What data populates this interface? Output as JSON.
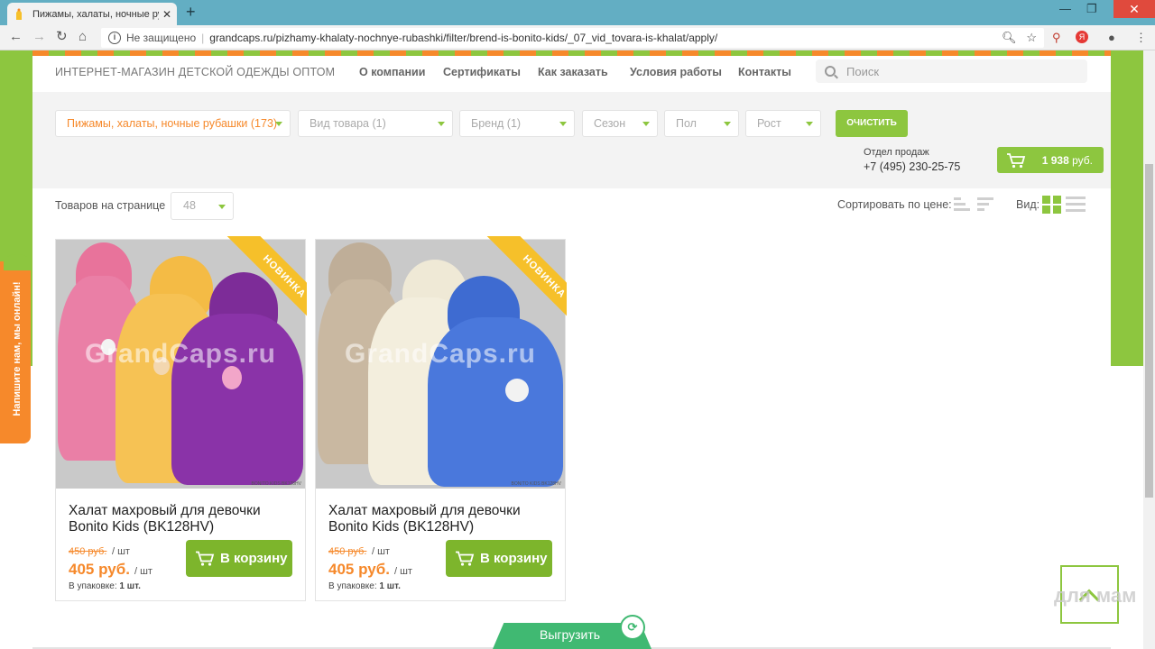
{
  "browser": {
    "tab_title": "Пижамы, халаты, ночные рубаш",
    "tab_close": "✕",
    "new_tab": "+",
    "security_label": "Не защищено",
    "separator": "|",
    "url": "grandcaps.ru/pizhamy-khalaty-nochnye-rubashki/filter/brend-is-bonito-kids/_07_vid_tovara-is-khalat/apply/",
    "window_controls": [
      "—",
      "❐",
      "✕"
    ]
  },
  "header": {
    "brand": "ИНТЕРНЕТ-МАГАЗИН ДЕТСКОЙ ОДЕЖДЫ ОПТОМ",
    "nav": [
      "О компании",
      "Сертификаты",
      "Как заказать",
      "Условия работы",
      "Контакты"
    ],
    "search_placeholder": "Поиск"
  },
  "filters": {
    "category": "Пижамы, халаты, ночные рубашки (173)",
    "product_type": "Вид товара (1)",
    "brand": "Бренд (1)",
    "season": "Сезон",
    "gender": "Пол",
    "height": "Рост",
    "clear_label": "ОЧИСТИТЬ"
  },
  "sales": {
    "label": "Отдел продаж",
    "phone": "+7 (495) 230-25-75"
  },
  "cart": {
    "total": "1 938",
    "currency": "руб."
  },
  "toolbar": {
    "per_page_label": "Товаров на странице",
    "per_page_value": "48",
    "sort_label": "Сортировать по цене:",
    "view_label": "Вид:"
  },
  "products": [
    {
      "badge": "НОВИНКА",
      "watermark": "GrandCaps.ru",
      "img_caption": "BONITO KIDS BK128HV",
      "name": "Халат махровый для девочки Bonito Kids (BK128HV)",
      "old_price": "450 руб.",
      "price": "405 руб.",
      "unit": "/ шт",
      "pack_label": "В упаковке:",
      "pack_value": "1 шт.",
      "buy_label": "В корзину"
    },
    {
      "badge": "НОВИНКА",
      "watermark": "GrandCaps.ru",
      "img_caption": "BONITO KIDS BK128HV",
      "name": "Халат махровый для девочки Bonito Kids (BK128HV)",
      "old_price": "450 руб.",
      "price": "405 руб.",
      "unit": "/ шт",
      "pack_label": "В упаковке:",
      "pack_value": "1 шт.",
      "buy_label": "В корзину"
    }
  ],
  "widgets": {
    "chat_label": "Напишите нам, мы онлайн!",
    "export_label": "Выгрузить",
    "watermark_text": "для мам"
  },
  "colors": {
    "green": "#8dc63f",
    "orange": "#f6892b",
    "browser_tab_bar": "#63aec3"
  }
}
